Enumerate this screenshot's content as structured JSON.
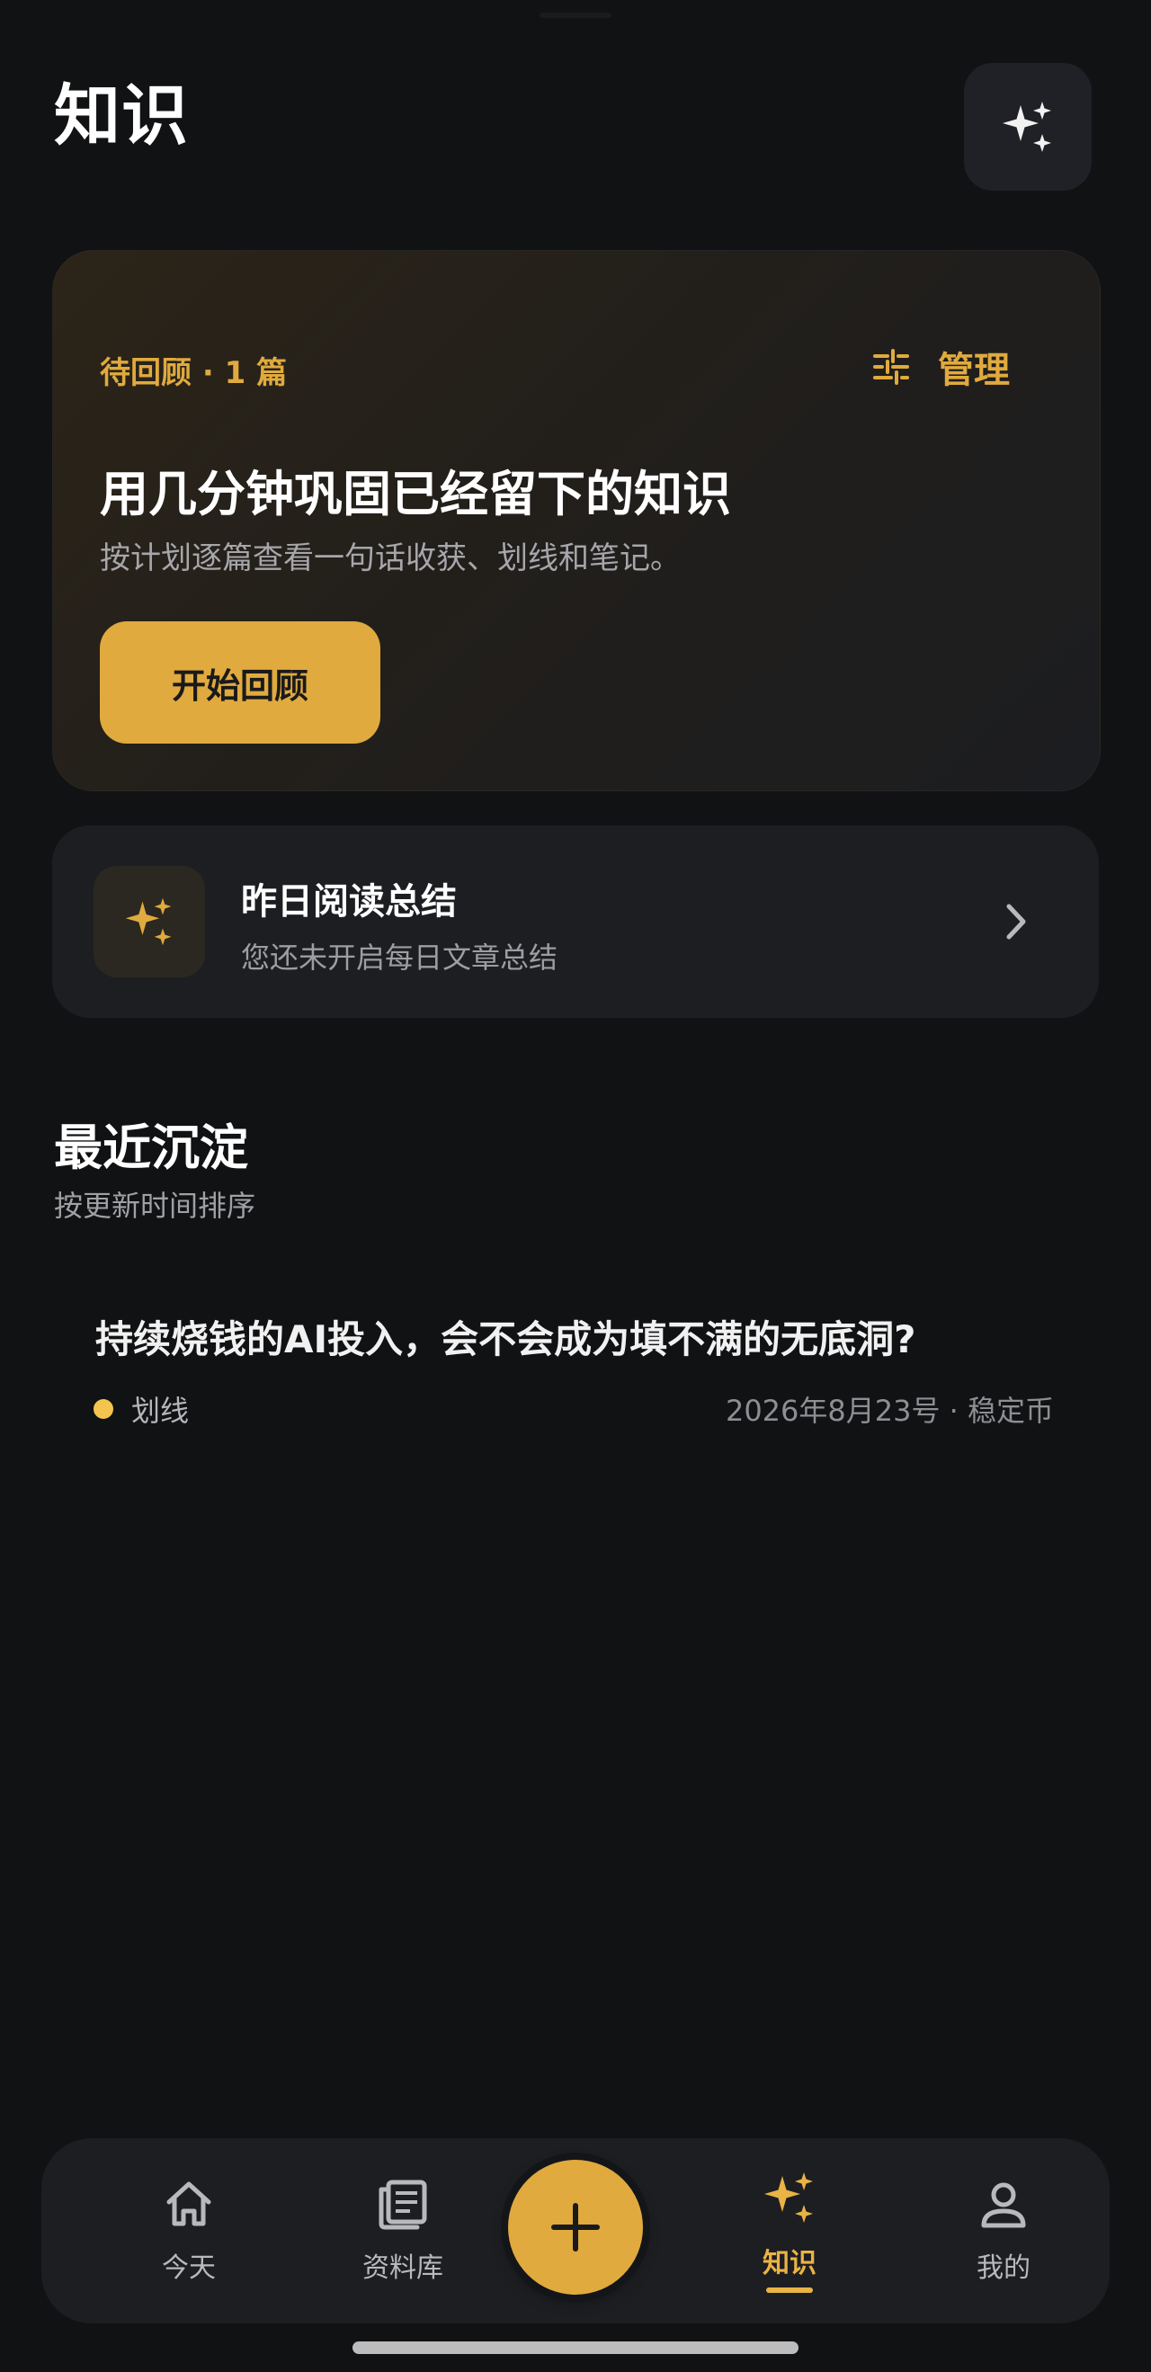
{
  "header": {
    "title": "知识"
  },
  "review_card": {
    "eyebrow": "待回顾 · 1 篇",
    "manage_label": "管理",
    "heading": "用几分钟巩固已经留下的知识",
    "subtitle": "按计划逐篇查看一句话收获、划线和笔记。",
    "start_label": "开始回顾"
  },
  "summary_card": {
    "title": "昨日阅读总结",
    "subtitle": "您还未开启每日文章总结"
  },
  "recent": {
    "title": "最近沉淀",
    "subtitle": "按更新时间排序",
    "items": [
      {
        "title": "持续烧钱的AI投入，会不会成为填不满的无底洞?",
        "tag": "划线",
        "meta": "2026年8月23号 · 稳定币"
      }
    ]
  },
  "tabbar": {
    "tabs": [
      {
        "label": "今天",
        "icon": "home-icon"
      },
      {
        "label": "资料库",
        "icon": "library-icon"
      },
      {
        "label": "知识",
        "icon": "sparkle-icon",
        "active": true
      },
      {
        "label": "我的",
        "icon": "user-icon"
      }
    ],
    "fab_icon": "plus-icon"
  },
  "colors": {
    "accent": "#e0aa3e",
    "background": "#111214",
    "card": "#1d1e22"
  }
}
